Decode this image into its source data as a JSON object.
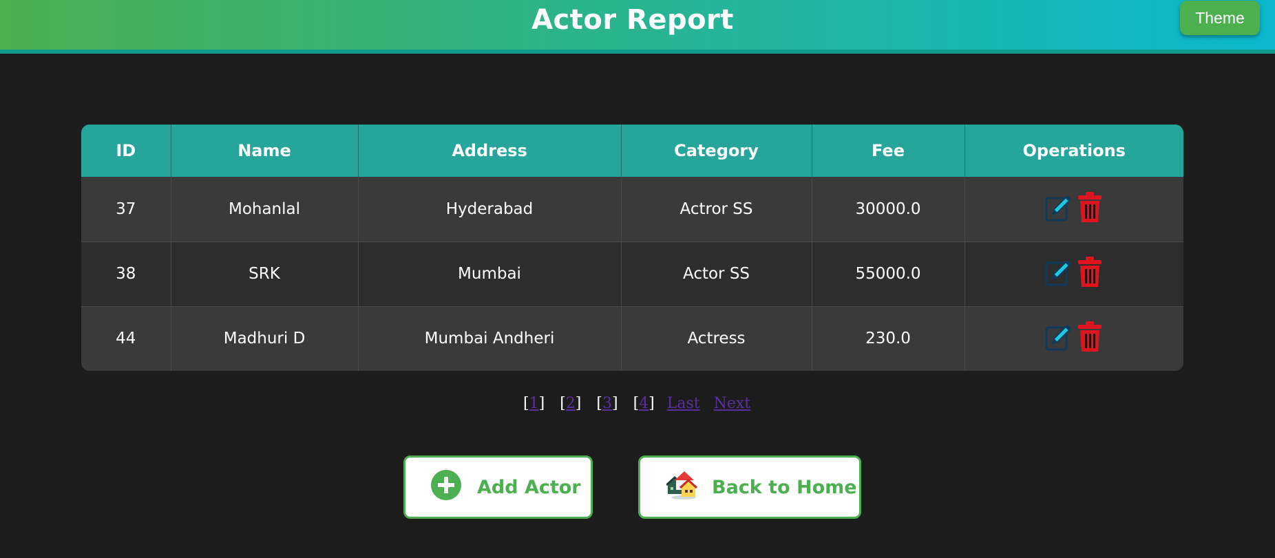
{
  "header": {
    "title": "Actor Report",
    "theme_label": "Theme"
  },
  "table": {
    "columns": [
      "ID",
      "Name",
      "Address",
      "Category",
      "Fee",
      "Operations"
    ],
    "rows": [
      {
        "id": "37",
        "name": "Mohanlal",
        "address": "Hyderabad",
        "category": "Actror SS",
        "fee": "30000.0"
      },
      {
        "id": "38",
        "name": "SRK",
        "address": "Mumbai",
        "category": "Actor SS",
        "fee": "55000.0"
      },
      {
        "id": "44",
        "name": "Madhuri D",
        "address": "Mumbai Andheri",
        "category": "Actress",
        "fee": "230.0"
      }
    ],
    "operation_icons": [
      "edit-icon",
      "delete-icon"
    ]
  },
  "pagination": {
    "pages": [
      "1",
      "2",
      "3",
      "4"
    ],
    "last_label": "Last",
    "next_label": "Next"
  },
  "actions": {
    "add_label": "Add Actor",
    "home_label": "Back to Home"
  },
  "colors": {
    "accent": "#4caf50",
    "header_cell": "#26a69a",
    "delete": "#e0141e",
    "edit": "#1ec8e0",
    "link": "#5b2fa0"
  }
}
